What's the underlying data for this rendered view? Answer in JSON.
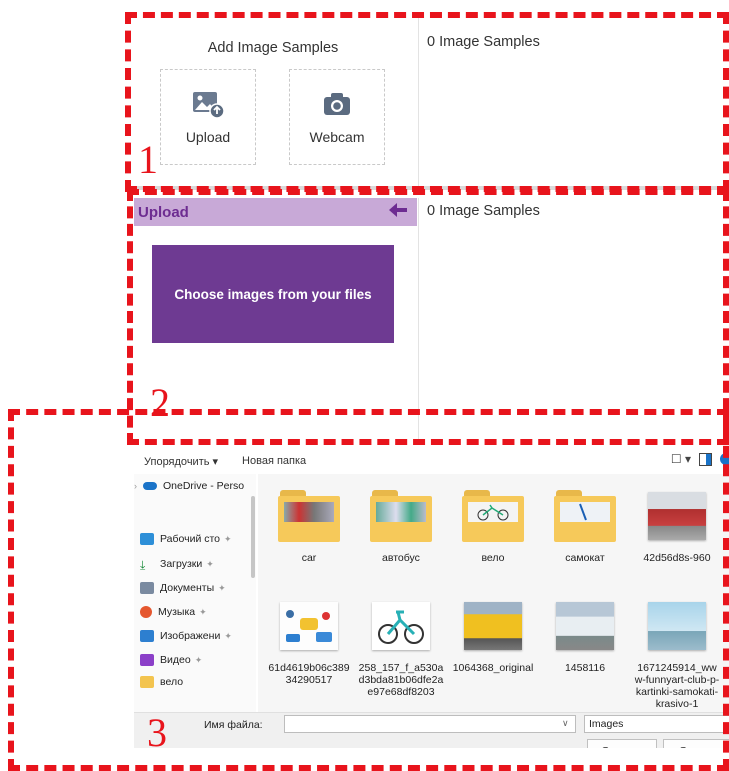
{
  "panel1": {
    "title": "Add Image Samples",
    "sample_count": "0 Image Samples",
    "upload_label": "Upload",
    "webcam_label": "Webcam",
    "upload_icon": "image-upload-icon",
    "webcam_icon": "camera-icon"
  },
  "panel2": {
    "header_title": "Upload",
    "back_icon": "arrow-left-icon",
    "sample_count": "0 Image Samples",
    "choose_button": "Choose images from your files"
  },
  "dialog": {
    "toolbar": {
      "organize": "Упорядочить ▾",
      "new_folder": "Новая папка"
    },
    "nav": [
      {
        "label": "OneDrive - Perso",
        "icon": "cloud-icon"
      },
      {
        "label": "Рабочий сто",
        "icon": "desktop-icon"
      },
      {
        "label": "Загрузки",
        "icon": "download-icon"
      },
      {
        "label": "Документы",
        "icon": "document-icon"
      },
      {
        "label": "Музыка",
        "icon": "music-icon"
      },
      {
        "label": "Изображени",
        "icon": "pictures-icon"
      },
      {
        "label": "Видео",
        "icon": "video-icon"
      },
      {
        "label": "вело",
        "icon": "folder-icon"
      }
    ],
    "files": [
      {
        "name": "car",
        "kind": "folder"
      },
      {
        "name": "автобус",
        "kind": "folder"
      },
      {
        "name": "вело",
        "kind": "folder"
      },
      {
        "name": "самокат",
        "kind": "folder"
      },
      {
        "name": "42d56d8s-960",
        "kind": "image"
      },
      {
        "name": "61d4619b06c38934290517",
        "kind": "image"
      },
      {
        "name": "258_157_f_a530ad3bda81b06dfe2ae97e68df8203",
        "kind": "image"
      },
      {
        "name": "1064368_original",
        "kind": "image"
      },
      {
        "name": "1458116",
        "kind": "image"
      },
      {
        "name": "1671245914_www-funnyart-club-p-kartinki-samokati-krasivo-1",
        "kind": "image"
      }
    ],
    "filename_label": "Имя файла:",
    "filename_value": "",
    "filetype": "Images",
    "open_button": "Открыть",
    "cancel_button": "Отмена"
  },
  "callouts": [
    "1",
    "2",
    "3"
  ],
  "colors": {
    "accent_purple": "#6e3a92",
    "header_lavender": "#c8a9d7",
    "callout_red": "#e8141c"
  }
}
